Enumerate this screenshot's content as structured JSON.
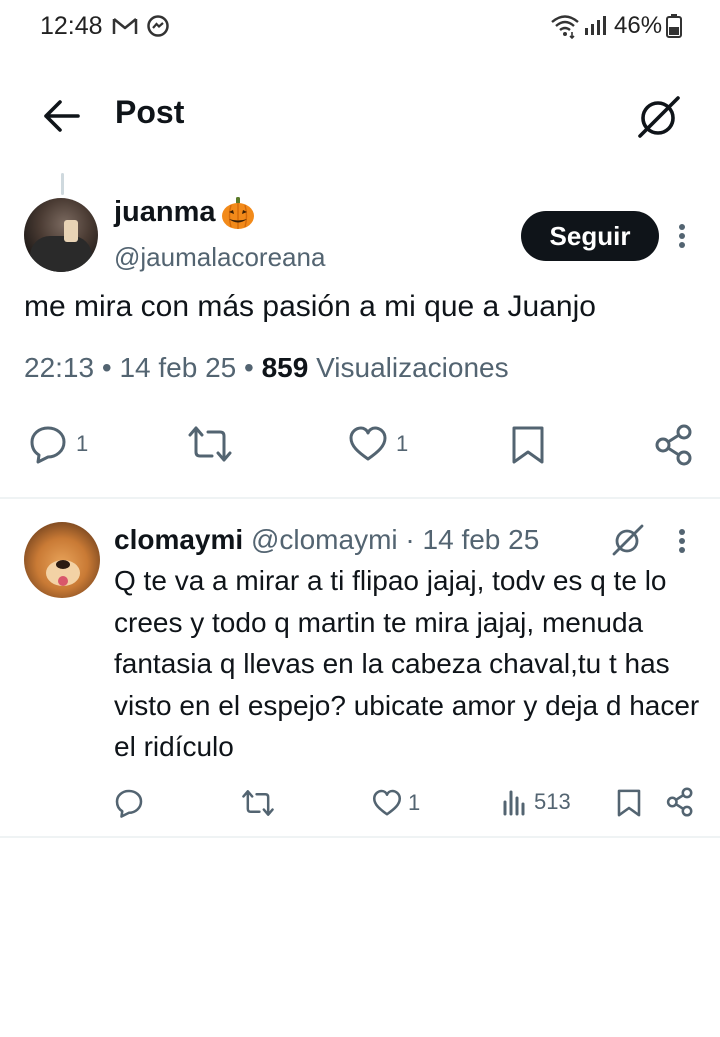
{
  "status_bar": {
    "time": "12:48",
    "battery": "46%",
    "icons": [
      "gmail-icon",
      "messenger-icon",
      "wifi-icon",
      "signal-icon",
      "battery-icon"
    ]
  },
  "header": {
    "title": "Post",
    "back_icon": "arrow-left-icon",
    "grok_icon": "grok-icon"
  },
  "post": {
    "author_name": "juanma",
    "author_handle": "@jaumalacoreana",
    "follow_label": "Seguir",
    "text": "me mira con más pasión a mi que a Juanjo",
    "time": "22:13",
    "date": "14 feb 25",
    "views_count": "859",
    "views_label": "Visualizaciones",
    "actions": {
      "reply_count": "1",
      "repost_count": "",
      "like_count": "1"
    }
  },
  "reply": {
    "author_name": "clomaymi",
    "author_handle": "@clomaymi",
    "separator": "·",
    "date": "14 feb 25",
    "text": "Q te va a mirar a ti flipao jajaj, todv es q te lo crees y todo q martin te mira jajaj, menuda fantasia q llevas en la cabeza chaval,tu t has visto en el espejo? ubicate amor y deja d hacer el ridículo",
    "actions": {
      "reply_count": "",
      "repost_count": "",
      "like_count": "1",
      "views_count": "513"
    }
  },
  "colors": {
    "text": "#0f1419",
    "secondary": "#536471",
    "divider": "#eff3f4",
    "button_bg": "#0f1419"
  }
}
